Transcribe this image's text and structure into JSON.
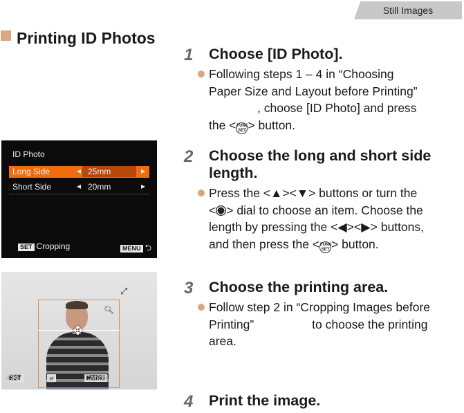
{
  "header": {
    "tag": "Still Images"
  },
  "section": {
    "title": "Printing ID Photos"
  },
  "steps": [
    {
      "num": "1",
      "title": "Choose [ID Photo].",
      "bullet_lines": [
        "Following steps 1 – 4 in “Choosing",
        "Paper Size and Layout before Printing”",
        ", choose [ID Photo] and press",
        "the <",
        "> button."
      ],
      "func_label": "FUNC SET"
    },
    {
      "num": "2",
      "title": "Choose the long and short side length.",
      "bullet_parts": [
        "Press the <▲><▼> buttons or turn the",
        "<",
        "> dial to choose an item. Choose the",
        "length by pressing the <◀><▶> buttons,",
        "and then press the <",
        "> button."
      ]
    },
    {
      "num": "3",
      "title": "Choose the printing area.",
      "bullet_lines": [
        "Follow step 2 in “Cropping Images before",
        "Printing”",
        "to choose the printing",
        "area."
      ]
    },
    {
      "num": "4",
      "title": "Print the image."
    }
  ],
  "screen1": {
    "title": "ID Photo",
    "rows": [
      {
        "label": "Long Side",
        "value": "25mm"
      },
      {
        "label": "Short Side",
        "value": "20mm"
      }
    ],
    "arrow_left": "◂",
    "arrow_right": "▸",
    "set_key": "SET",
    "footer_label": "Cropping",
    "menu_key": "MENU",
    "back_symbol": "⮌"
  },
  "screen2": {
    "set_key": "SET",
    "ok_label": "OK",
    "menu_key": "MENU",
    "cancel_label": "Cancel"
  },
  "colors": {
    "accent": "#ee6e0e",
    "bullet": "#d9a87a",
    "tag_bg": "#c8c8c8"
  }
}
